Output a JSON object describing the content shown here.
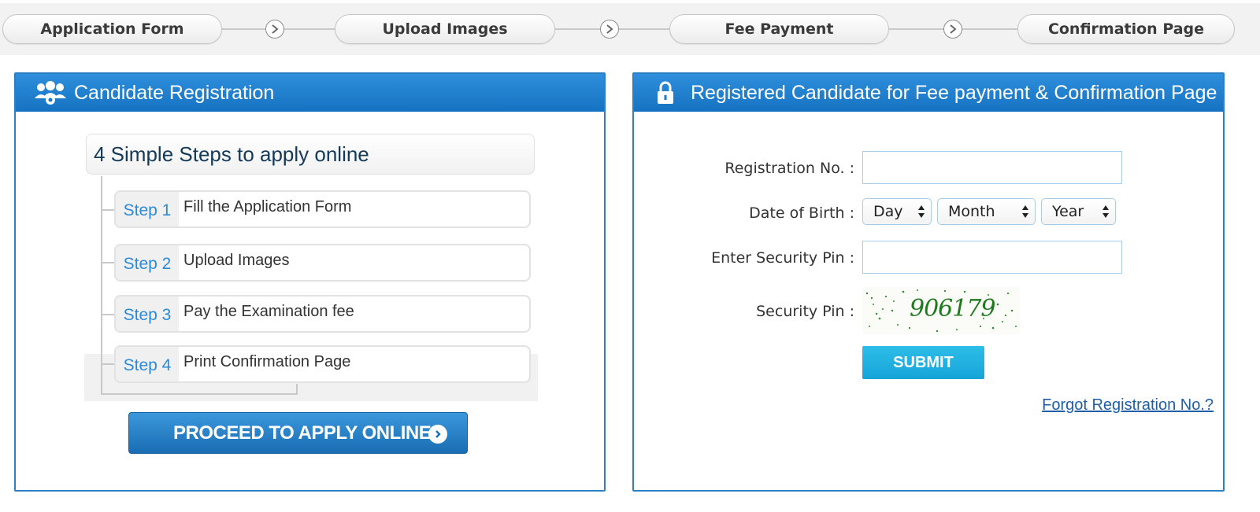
{
  "steps_bar": {
    "items": [
      {
        "label": "Application Form"
      },
      {
        "label": "Upload Images"
      },
      {
        "label": "Fee Payment"
      },
      {
        "label": "Confirmation Page"
      }
    ]
  },
  "registration": {
    "title": "Candidate Registration",
    "steps_heading": "4 Simple Steps to apply online",
    "steps": [
      {
        "label": "Step 1",
        "text": "Fill the Application Form"
      },
      {
        "label": "Step 2",
        "text": "Upload Images"
      },
      {
        "label": "Step 3",
        "text": "Pay the Examination fee"
      },
      {
        "label": "Step 4",
        "text": "Print Confirmation Page"
      }
    ],
    "proceed_label": "PROCEED TO APPLY ONLINE"
  },
  "login": {
    "title": "Registered Candidate for Fee payment & Confirmation Page",
    "registration_no_label": "Registration No. :",
    "registration_no_value": "",
    "dob_label": "Date of Birth :",
    "dob_day": "Day",
    "dob_month": "Month",
    "dob_year": "Year",
    "security_pin_input_label": "Enter Security Pin :",
    "security_pin_input_value": "",
    "security_pin_label": "Security Pin :",
    "captcha_code": "906179",
    "submit_label": "SUBMIT",
    "forgot_link": "Forgot Registration No.?"
  },
  "colors": {
    "panel_header": "#1a7acb",
    "step_label": "#2a8ad8",
    "submit": "#1cacdf",
    "captcha_text": "#1e7a1e",
    "link": "#1f5fa8"
  },
  "icons": {
    "step_arrow": "chevron-right-circle-icon",
    "registration": "users-icon",
    "login": "lock-icon",
    "proceed": "arrow-right-circle-icon"
  }
}
